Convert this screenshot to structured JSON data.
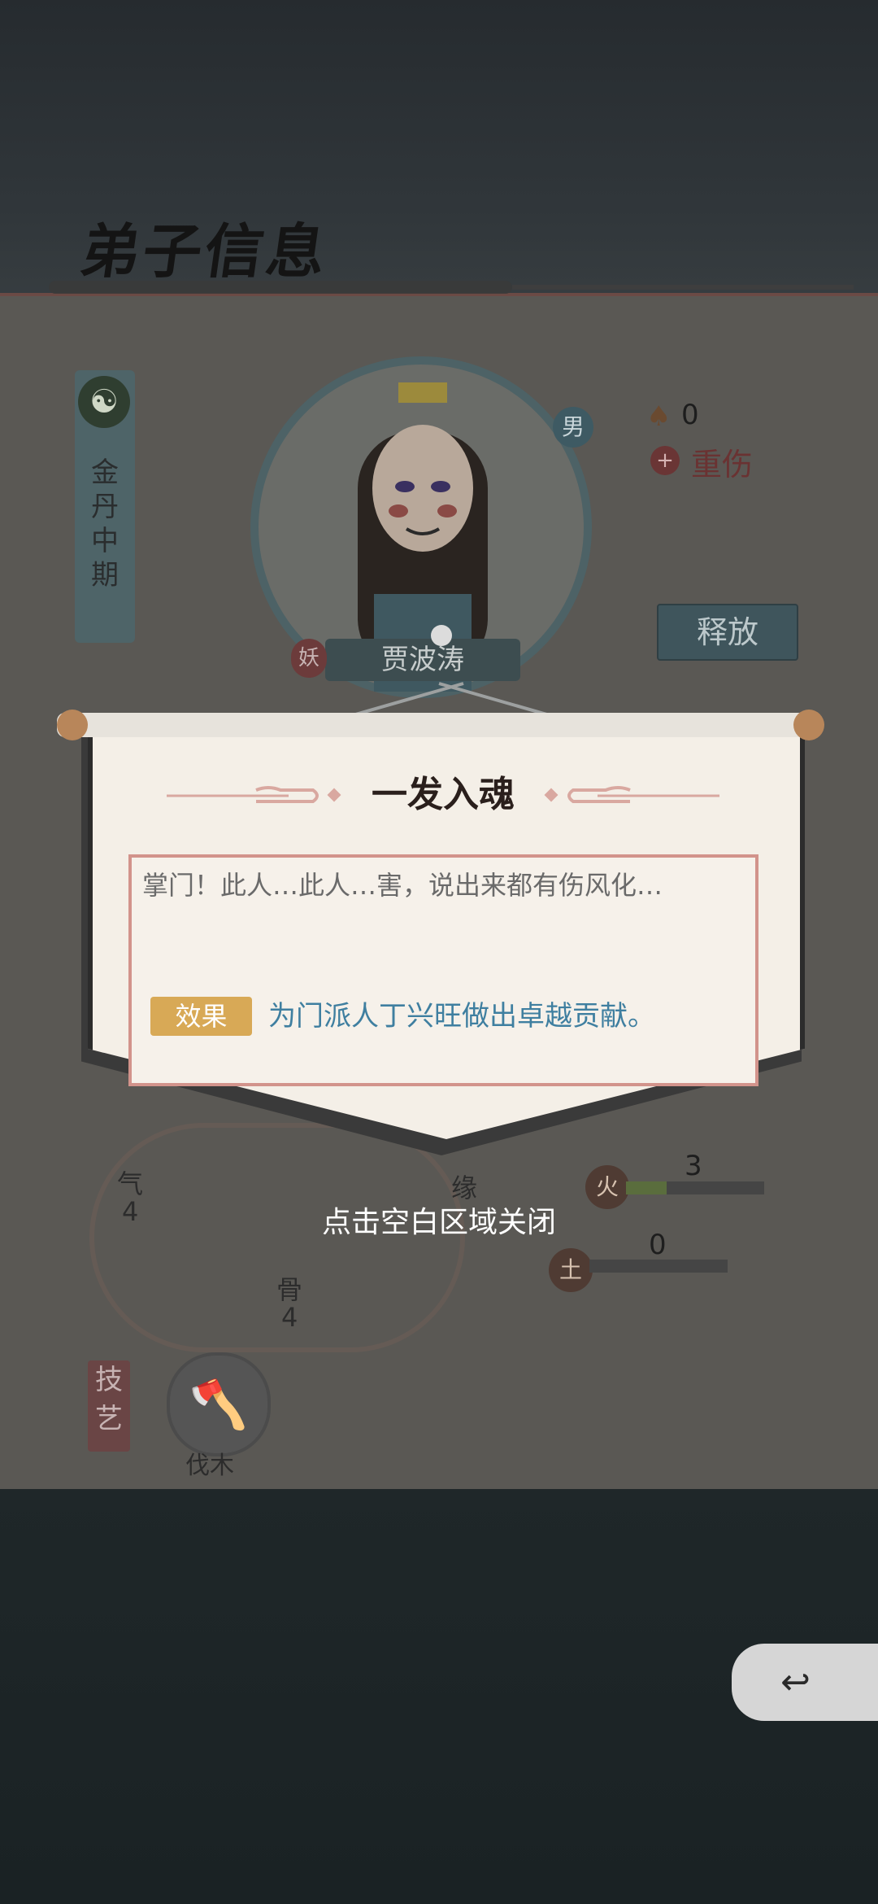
{
  "header": {
    "title": "弟子信息"
  },
  "disciple": {
    "rank": "金丹中期",
    "rank_icon": "☯",
    "gender": "男",
    "name": "贾波涛",
    "trait_badge": "妖",
    "mushroom_count": "0",
    "injury": "重伤",
    "release_label": "释放"
  },
  "attributes": {
    "qi_label": "气",
    "qi_value": "4",
    "gu_label": "骨",
    "gu_value": "4",
    "yuan_label": "缘",
    "fire_label": "火",
    "fire_value": "3",
    "earth_label": "土",
    "earth_value": "0"
  },
  "skills": {
    "tag": "技艺",
    "item_name": "伐木",
    "item_icon": "🪓"
  },
  "popup": {
    "title": "一发入魂",
    "flavor_text": "掌门！此人…此人…害，说出来都有伤风化…",
    "effect_tag": "效果",
    "effect_text": "为门派人丁兴旺做出卓越贡献。",
    "close_hint": "点击空白区域关闭"
  },
  "nav": {
    "back_label": "↩"
  },
  "colors": {
    "accent_effect": "#d8a956",
    "effect_text": "#3f7fa0",
    "content_border": "#d2938b"
  }
}
